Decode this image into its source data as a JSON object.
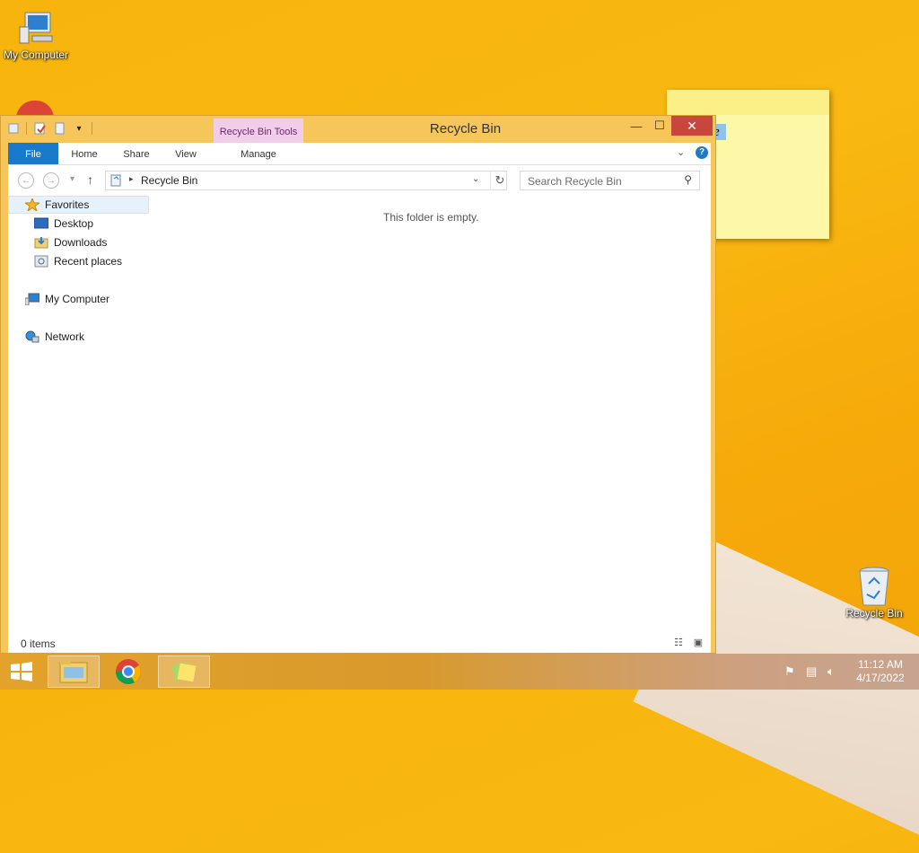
{
  "desktop": {
    "icons": [
      {
        "label": "My Computer"
      },
      {
        "label": "Recycle Bin"
      }
    ]
  },
  "sticky_note": {
    "visible_text": "e"
  },
  "window": {
    "title": "Recycle Bin",
    "contextual_tab": "Recycle Bin Tools",
    "controls": {
      "minimize": "—",
      "maximize": "☐",
      "close": "✕"
    },
    "ribbon_tabs": [
      "File",
      "Home",
      "Share",
      "View",
      "Manage"
    ],
    "help": "?",
    "address": {
      "crumb": "Recycle Bin"
    },
    "search": {
      "placeholder": "Search Recycle Bin"
    },
    "nav_pane": {
      "favorites": "Favorites",
      "desktop": "Desktop",
      "downloads": "Downloads",
      "recent": "Recent places",
      "computer": "My Computer",
      "network": "Network"
    },
    "empty_message": "This folder is empty.",
    "status": "0 items"
  },
  "taskbar": {
    "time": "11:12 AM",
    "date": "4/17/2022"
  },
  "colors": {
    "accent": "#1979ca",
    "close": "#c9463d",
    "window_frame": "#f7c65a",
    "contextual_tab": "#f0cde8"
  }
}
